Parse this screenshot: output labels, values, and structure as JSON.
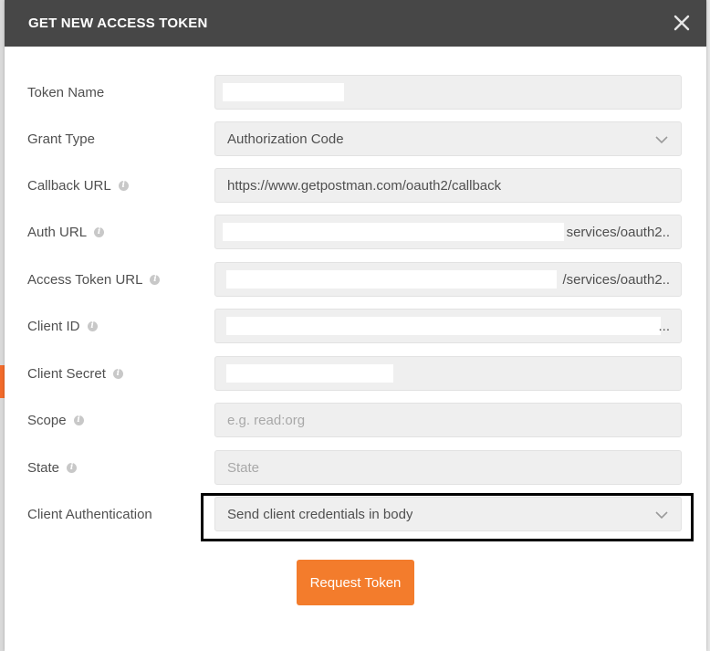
{
  "dialog": {
    "title": "GET NEW ACCESS TOKEN"
  },
  "form": {
    "token_name": {
      "label": "Token Name",
      "value": ""
    },
    "grant_type": {
      "label": "Grant Type",
      "value": "Authorization Code"
    },
    "callback_url": {
      "label": "Callback URL",
      "value": "https://www.getpostman.com/oauth2/callback"
    },
    "auth_url": {
      "label": "Auth URL",
      "value_visible": "services/oauth2.."
    },
    "access_token_url": {
      "label": "Access Token URL",
      "value_visible": "/services/oauth2.."
    },
    "client_id": {
      "label": "Client ID",
      "value_visible": "..."
    },
    "client_secret": {
      "label": "Client Secret",
      "value": ""
    },
    "scope": {
      "label": "Scope",
      "placeholder": "e.g. read:org"
    },
    "state": {
      "label": "State",
      "placeholder": "State"
    },
    "client_authentication": {
      "label": "Client Authentication",
      "value": "Send client credentials in body"
    }
  },
  "actions": {
    "request_token_label": "Request Token"
  },
  "colors": {
    "header_bg": "#474747",
    "accent": "#f37c2c",
    "field_bg": "#efefef",
    "highlight": "#000000"
  },
  "icons": {
    "close": "close-icon",
    "info": "info-icon",
    "dropdown": "chevron-down-icon"
  }
}
